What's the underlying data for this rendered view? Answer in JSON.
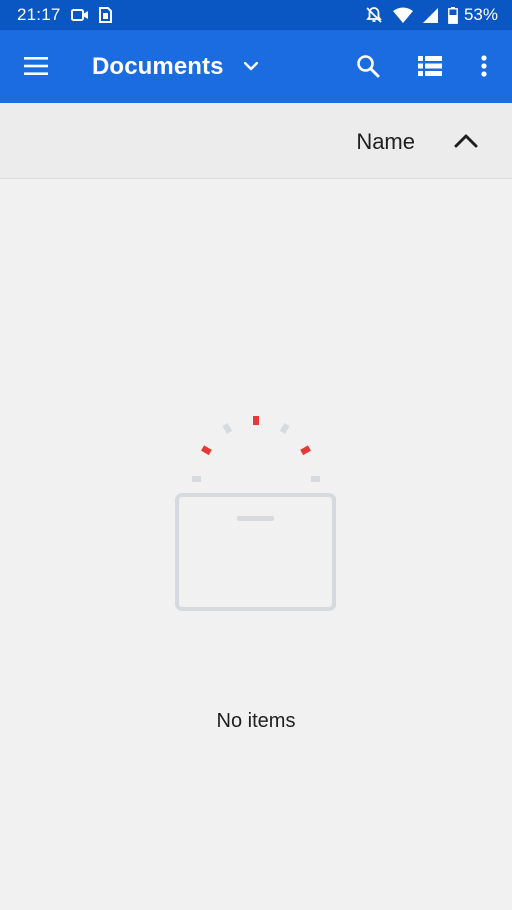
{
  "status_bar": {
    "time": "21:17",
    "battery_percent": "53%",
    "icons": [
      "video-camera-icon",
      "sim-card-icon",
      "notifications-off-icon",
      "wifi-icon",
      "signal-icon",
      "battery-icon"
    ]
  },
  "app_bar": {
    "title": "Documents",
    "icons": [
      "menu-icon",
      "chevron-down-icon",
      "search-icon",
      "list-view-icon",
      "more-vert-icon"
    ]
  },
  "sort_header": {
    "label": "Name",
    "direction_icon": "chevron-up-icon"
  },
  "empty_state": {
    "message": "No items",
    "illustration": "empty-tray-icon"
  },
  "colors": {
    "status_bar": "#0a56c2",
    "app_bar": "#1a6ce0",
    "background": "#f1f1f1",
    "sort_header_bg": "#ececec",
    "illustration_gray": "#d6d9de",
    "accent_red": "#e53935"
  }
}
